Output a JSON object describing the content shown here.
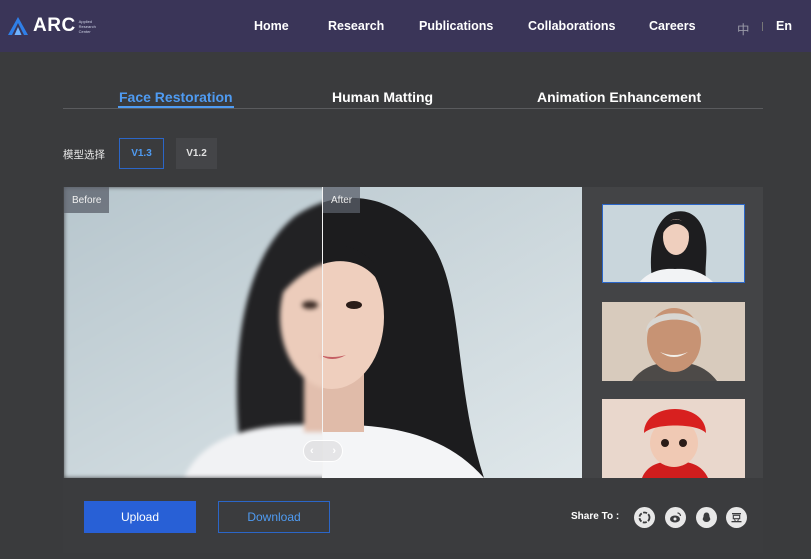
{
  "nav": {
    "logo_text": "ARC",
    "logo_sub": "Applied Research Center",
    "links": [
      "Home",
      "Research",
      "Publications",
      "Collaborations",
      "Careers"
    ],
    "lang_zh": "中",
    "lang_en": "En"
  },
  "tabs": [
    {
      "label": "Face Restoration",
      "active": true
    },
    {
      "label": "Human Matting",
      "active": false
    },
    {
      "label": "Animation Enhancement",
      "active": false
    }
  ],
  "model_select": {
    "label": "模型选择",
    "options": [
      "V1.3",
      "V1.2"
    ],
    "selected": "V1.3"
  },
  "viewer": {
    "before_label": "Before",
    "after_label": "After",
    "slider_left": "‹",
    "slider_right": "›"
  },
  "thumbnails": [
    {
      "name": "young-woman",
      "selected": true
    },
    {
      "name": "elderly-man",
      "selected": false
    },
    {
      "name": "baby-red-hat",
      "selected": false
    }
  ],
  "actions": {
    "upload_label": "Upload",
    "download_label": "Download",
    "share_label": "Share To :"
  },
  "share_icons": [
    "wechat-moments-icon",
    "weibo-icon",
    "qq-icon",
    "douban-icon"
  ],
  "colors": {
    "nav_bg": "#3a3558",
    "page_bg": "#3a3b3d",
    "accent": "#4f9bf2",
    "primary_button": "#2860d6"
  }
}
